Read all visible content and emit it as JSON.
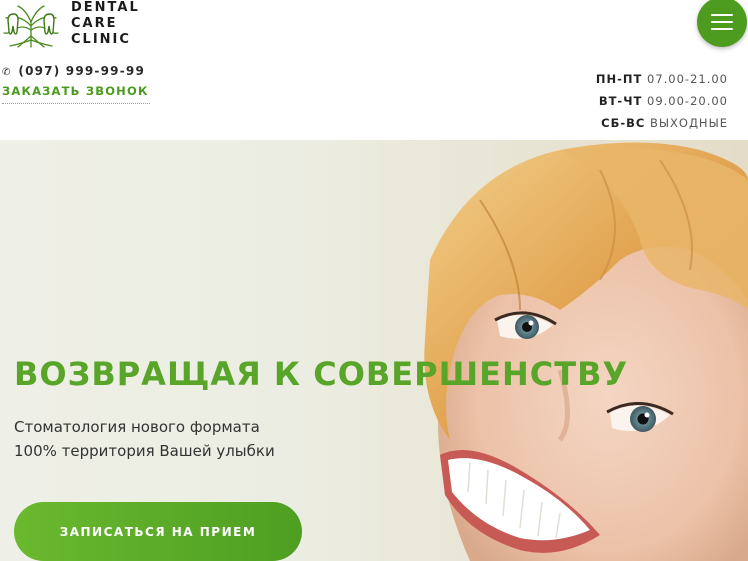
{
  "logo": {
    "line1": "DENTAL",
    "line2": "CARE",
    "line3": "CLINIC",
    "icon": "tree-teeth-icon"
  },
  "contact": {
    "phone": "(097) 999-99-99",
    "callback_label": "ЗАКАЗАТЬ ЗВОНОК"
  },
  "hours": [
    {
      "days": "ПН-ПТ",
      "time": "07.00-21.00"
    },
    {
      "days": "ВТ-ЧТ",
      "time": "09.00-20.00"
    },
    {
      "days": "СБ-ВС",
      "time": "ВЫХОДНЫЕ"
    }
  ],
  "menu": {
    "icon": "hamburger-icon"
  },
  "hero": {
    "title": "ВОЗВРАЩАЯ К СОВЕРШЕНСТВУ",
    "subtitle_line1": "Стоматология нового формата",
    "subtitle_line2": "100% территория Вашей улыбки",
    "cta_label": "ЗАПИСАТЬСЯ НА ПРИЕМ"
  },
  "colors": {
    "accent_green": "#4e9c1f",
    "title_green": "#58a52a"
  }
}
